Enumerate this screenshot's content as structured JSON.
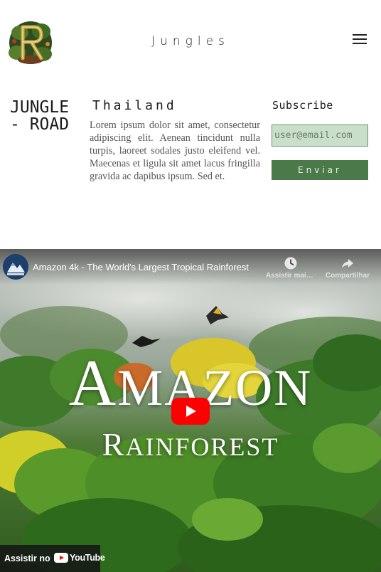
{
  "header": {
    "title": "Jungles",
    "menu_icon": "hamburger-menu-icon"
  },
  "brand": {
    "line1": "JUNGLE",
    "line2": "- ROAD"
  },
  "article": {
    "heading": "Thailand",
    "body": "Lorem ipsum dolor sit amet, consectetur adipiscing elit. Aenean tincidunt nulla turpis, laoreet sodales justo eleifend vel. Maecenas et ligula sit amet lacus fringilla gravida ac dapibus ipsum. Sed et."
  },
  "subscribe": {
    "heading": "Subscribe",
    "email_placeholder": "user@email.com",
    "submit_label": "Enviar"
  },
  "video": {
    "title": "Amazon 4k - The World's Largest Tropical Rainforest",
    "action_watch_later": "Assistir mais tarde",
    "action_share": "Compartilhar",
    "overlay_title_first": "A",
    "overlay_title_rest": "MAZON",
    "overlay_sub_first": "R",
    "overlay_sub_rest": "AINFOREST",
    "watch_on_label": "Assistir no",
    "youtube_word": "YouTube"
  },
  "colors": {
    "accent_green": "#4a7a4a",
    "input_bg": "#c9dfc9",
    "play_red": "#ff0000"
  }
}
